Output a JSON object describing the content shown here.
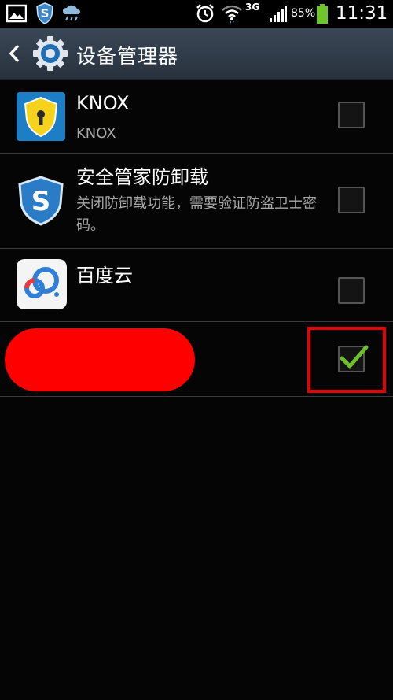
{
  "status_bar": {
    "network": "3G",
    "battery": "85%",
    "time": "11:31",
    "icons": [
      "gallery-icon",
      "security-shield-icon",
      "weather-icon",
      "alarm-icon",
      "wifi-icon",
      "signal-icon",
      "battery-icon"
    ]
  },
  "action_bar": {
    "title": "设备管理器",
    "icons": [
      "back-icon",
      "settings-gear-icon"
    ]
  },
  "device_admins": [
    {
      "title": "KNOX",
      "subtitle": "KNOX",
      "checked": false,
      "icon": "knox-shield-icon"
    },
    {
      "title": "安全管家防卸载",
      "subtitle": "关闭防卸载功能，需要验证防盗卫士密码。",
      "checked": false,
      "icon": "security-s-shield-icon"
    },
    {
      "title": "百度云",
      "subtitle": "",
      "checked": false,
      "icon": "baidu-cloud-icon"
    },
    {
      "title": "",
      "subtitle": "",
      "checked": true,
      "icon": "",
      "redacted": true
    }
  ],
  "colors": {
    "background": "#050505",
    "action_bar": "#323d4a",
    "divider": "#3a3a3a",
    "check_green": "#6fbf2a",
    "redaction": "#ff0000",
    "highlight": "#e60000"
  }
}
